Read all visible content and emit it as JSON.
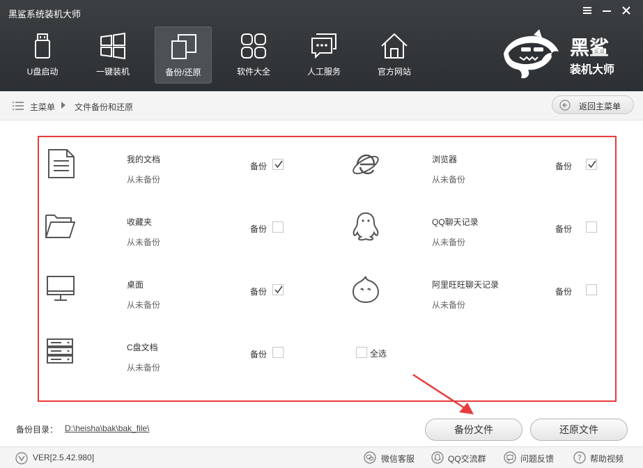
{
  "app": {
    "title": "黑鲨系统装机大师"
  },
  "window_controls": {
    "menu": "≡",
    "minimize": "—",
    "close": "✕"
  },
  "nav": [
    {
      "label": "U盘启动",
      "icon": "usb-drive-icon",
      "active": false
    },
    {
      "label": "一键装机",
      "icon": "windows-icon",
      "active": false
    },
    {
      "label": "备份/还原",
      "icon": "backup-restore-icon",
      "active": true
    },
    {
      "label": "软件大全",
      "icon": "apps-grid-icon",
      "active": false
    },
    {
      "label": "人工服务",
      "icon": "chat-bubble-icon",
      "active": false
    },
    {
      "label": "官方网站",
      "icon": "home-icon",
      "active": false
    }
  ],
  "logo": {
    "line1": "黑鲨",
    "line2": "装机大师"
  },
  "breadcrumb": {
    "home": "主菜单",
    "current": "文件备份和还原"
  },
  "back_button": "返回主菜单",
  "backup_items": [
    {
      "name": "我的文档",
      "status": "从未备份",
      "backup_label": "备份",
      "checked": true,
      "icon": "document-icon"
    },
    {
      "name": "浏览器",
      "status": "从未备份",
      "backup_label": "备份",
      "checked": true,
      "icon": "ie-browser-icon"
    },
    {
      "name": "收藏夹",
      "status": "从未备份",
      "backup_label": "备份",
      "checked": false,
      "icon": "folder-icon"
    },
    {
      "name": "QQ聊天记录",
      "status": "从未备份",
      "backup_label": "备份",
      "checked": false,
      "icon": "qq-penguin-icon"
    },
    {
      "name": "桌面",
      "status": "从未备份",
      "backup_label": "备份",
      "checked": true,
      "icon": "monitor-icon"
    },
    {
      "name": "阿里旺旺聊天记录",
      "status": "从未备份",
      "backup_label": "备份",
      "checked": false,
      "icon": "wangwang-icon"
    },
    {
      "name": "C盘文档",
      "status": "从未备份",
      "backup_label": "备份",
      "checked": false,
      "icon": "server-disk-icon"
    }
  ],
  "select_all": {
    "label": "全选",
    "checked": false
  },
  "backup_dir": {
    "label": "备份目录：",
    "path": "D:\\heisha\\bak\\bak_file\\"
  },
  "buttons": {
    "backup": "备份文件",
    "restore": "还原文件"
  },
  "footer": {
    "version": "VER[2.5.42.980]",
    "links": [
      "微信客服",
      "QQ交流群",
      "问题反馈",
      "帮助视频"
    ]
  },
  "colors": {
    "header_bg": "#35393c",
    "panel_border": "#e83b3b",
    "annotation_arrow": "#e83b3b"
  }
}
